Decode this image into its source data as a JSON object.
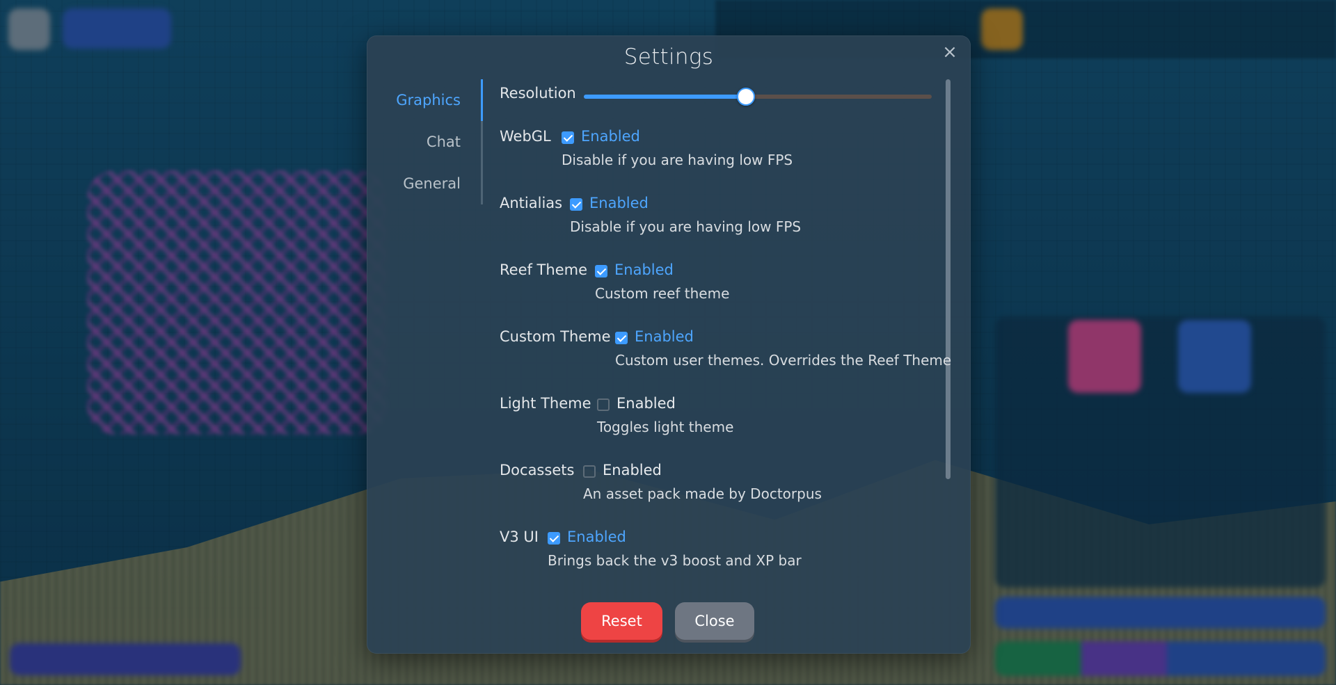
{
  "dialog": {
    "title": "Settings",
    "close_icon": "close-icon"
  },
  "nav": {
    "items": [
      {
        "label": "Graphics",
        "active": true
      },
      {
        "label": "Chat",
        "active": false
      },
      {
        "label": "General",
        "active": false
      }
    ]
  },
  "resolution": {
    "label": "Resolution",
    "value_fraction": 0.465
  },
  "settings": [
    {
      "label": "WebGL",
      "state_label": "Enabled",
      "checked": true,
      "description": "Disable if you are having low FPS"
    },
    {
      "label": "Antialias",
      "state_label": "Enabled",
      "checked": true,
      "description": "Disable if you are having low FPS"
    },
    {
      "label": "Reef Theme",
      "state_label": "Enabled",
      "checked": true,
      "description": "Custom reef theme"
    },
    {
      "label": "Custom Theme",
      "state_label": "Enabled",
      "checked": true,
      "description": "Custom user themes. Overrides the Reef Theme"
    },
    {
      "label": "Light Theme",
      "state_label": "Enabled",
      "checked": false,
      "description": "Toggles light theme"
    },
    {
      "label": "Docassets",
      "state_label": "Enabled",
      "checked": false,
      "description": "An asset pack made by Doctorpus"
    },
    {
      "label": "V3 UI",
      "state_label": "Enabled",
      "checked": true,
      "description": "Brings back the v3 boost and XP bar"
    }
  ],
  "buttons": {
    "reset": "Reset",
    "close": "Close"
  },
  "colors": {
    "accent": "#3d9bff",
    "reset": "#ee4444",
    "close": "#6e7682"
  }
}
